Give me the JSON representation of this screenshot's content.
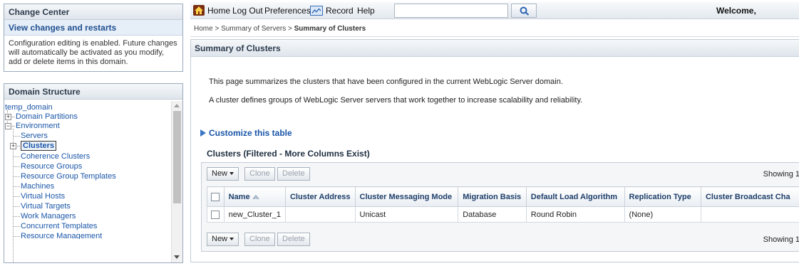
{
  "change_center": {
    "title": "Change Center",
    "link": "View changes and restarts",
    "message": "Configuration editing is enabled. Future changes will automatically be activated as you modify, add or delete items in this domain."
  },
  "domain_structure": {
    "title": "Domain Structure",
    "items": [
      {
        "label": "temp_domain"
      },
      {
        "label": "Domain Partitions"
      },
      {
        "label": "Environment"
      },
      {
        "label": "Servers"
      },
      {
        "label": "Clusters"
      },
      {
        "label": "Coherence Clusters"
      },
      {
        "label": "Resource Groups"
      },
      {
        "label": "Resource Group Templates"
      },
      {
        "label": "Machines"
      },
      {
        "label": "Virtual Hosts"
      },
      {
        "label": "Virtual Targets"
      },
      {
        "label": "Work Managers"
      },
      {
        "label": "Concurrent Templates"
      },
      {
        "label": "Resource Management"
      }
    ]
  },
  "toolbar": {
    "home": "Home",
    "logout": "Log Out",
    "preferences": "Preferences",
    "record": "Record",
    "help": "Help",
    "search_value": "",
    "welcome": "Welcome,"
  },
  "breadcrumb": {
    "home": "Home >",
    "servers": "Summary of Servers >",
    "current": "Summary of Clusters"
  },
  "page": {
    "title": "Summary of Clusters",
    "para1": "This page summarizes the clusters that have been configured in the current WebLogic Server domain.",
    "para2": "A cluster defines groups of WebLogic Server servers that work together to increase scalability and reliability.",
    "customize": "Customize this table",
    "table_title": "Clusters (Filtered - More Columns Exist)"
  },
  "table_actions": {
    "new": "New",
    "clone": "Clone",
    "delete": "Delete",
    "showing": "Showing 1"
  },
  "table": {
    "columns": [
      "Name",
      "Cluster Address",
      "Cluster Messaging Mode",
      "Migration Basis",
      "Default Load Algorithm",
      "Replication Type",
      "Cluster Broadcast Cha"
    ],
    "rows": [
      [
        "new_Cluster_1",
        "",
        "Unicast",
        "Database",
        "Round Robin",
        "(None)",
        ""
      ]
    ]
  },
  "colors": {
    "link": "#1a56a8",
    "header_text": "#1f3f6a",
    "panel_border": "#9aaabb"
  },
  "icons": [
    "home-icon",
    "record-icon",
    "search-icon",
    "sort-icon",
    "expand-icon",
    "customize-arrow-icon"
  ]
}
